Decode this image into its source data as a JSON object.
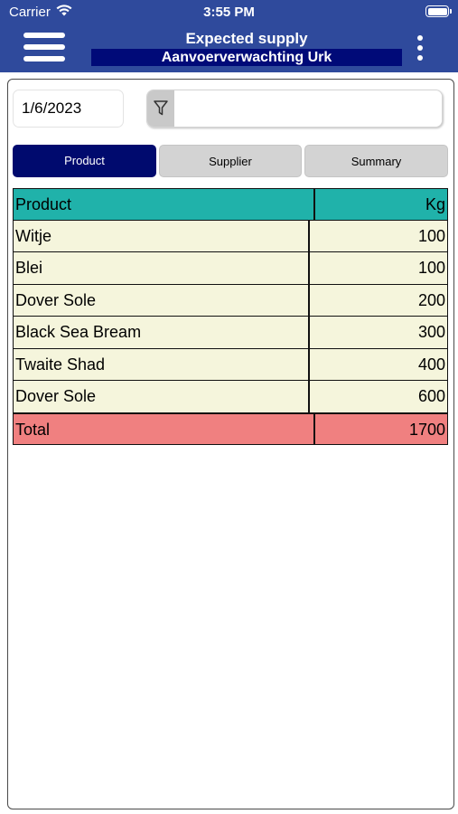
{
  "status_bar": {
    "carrier": "Carrier",
    "time": "3:55 PM"
  },
  "nav": {
    "title": "Expected supply",
    "subtitle": "Aanvoerverwachting Urk",
    "menu_icon": "hamburger-menu-icon",
    "more_icon": "more-vertical-icon"
  },
  "filters": {
    "date_value": "1/6/2023",
    "search_value": "",
    "filter_icon": "funnel-icon"
  },
  "tabs": [
    {
      "label": "Product",
      "active": true
    },
    {
      "label": "Supplier",
      "active": false
    },
    {
      "label": "Summary",
      "active": false
    }
  ],
  "table": {
    "columns": [
      "Product",
      "Kg"
    ],
    "rows": [
      {
        "product": "Witje",
        "kg": "100"
      },
      {
        "product": "Blei",
        "kg": "100"
      },
      {
        "product": "Dover Sole",
        "kg": "200"
      },
      {
        "product": "Black Sea Bream",
        "kg": "300"
      },
      {
        "product": "Twaite Shad",
        "kg": "400"
      },
      {
        "product": "Dover Sole",
        "kg": "600"
      }
    ],
    "total": {
      "label": "Total",
      "kg": "1700"
    }
  },
  "colors": {
    "header_bg": "#2f4a9c",
    "subtitle_bg": "#000a78",
    "tab_active": "#000a6e",
    "table_header": "#20b2aa",
    "table_row": "#f5f5dc",
    "table_total": "#f08080"
  }
}
